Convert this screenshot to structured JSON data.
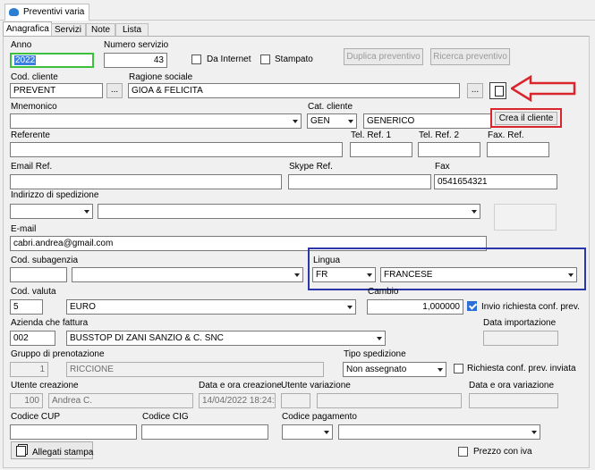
{
  "window": {
    "tab_title": "Preventivi varia"
  },
  "tabs": [
    "Anagrafica",
    "Servizi",
    "Note",
    "Lista"
  ],
  "form": {
    "anno": {
      "label": "Anno",
      "value": "2022"
    },
    "numero_servizio": {
      "label": "Numero servizio",
      "value": "43"
    },
    "da_internet": {
      "label": "Da Internet"
    },
    "stampato": {
      "label": "Stampato"
    },
    "duplica_preventivo": "Duplica preventivo",
    "ricerca_preventivo": "Ricerca preventivo",
    "cod_cliente": {
      "label": "Cod. cliente",
      "value": "PREVENT"
    },
    "ragione_sociale": {
      "label": "Ragione sociale",
      "value": "GIOA & FELICITA"
    },
    "ellipsis": "...",
    "mnemonico": {
      "label": "Mnemonico",
      "value": ""
    },
    "cat_cliente": {
      "label": "Cat. cliente",
      "code": "GEN",
      "desc": "GENERICO"
    },
    "crea_cliente": "Crea il cliente",
    "referente": {
      "label": "Referente"
    },
    "tel_ref_1": {
      "label": "Tel. Ref. 1"
    },
    "tel_ref_2": {
      "label": "Tel. Ref. 2"
    },
    "fax_ref": {
      "label": "Fax. Ref."
    },
    "email_ref": {
      "label": "Email Ref."
    },
    "skype_ref": {
      "label": "Skype Ref."
    },
    "fax": {
      "label": "Fax",
      "value": "0541654321"
    },
    "indirizzo_spedizione": {
      "label": "Indirizzo di spedizione"
    },
    "email": {
      "label": "E-mail",
      "value": "cabri.andrea@gmail.com"
    },
    "cod_subagenzia": {
      "label": "Cod. subagenzia"
    },
    "lingua": {
      "label": "Lingua",
      "code": "FR",
      "desc": "FRANCESE"
    },
    "cod_valuta": {
      "label": "Cod. valuta",
      "code": "5",
      "desc": "EURO"
    },
    "cambio": {
      "label": "Cambio",
      "value": "1,000000"
    },
    "invio_richiesta": {
      "label": "Invio richiesta conf. prev."
    },
    "azienda_fattura": {
      "label": "Azienda che fattura",
      "code": "002",
      "desc": "BUSSTOP DI ZANI SANZIO & C. SNC"
    },
    "data_importazione": {
      "label": "Data importazione"
    },
    "gruppo_prenotazione": {
      "label": "Gruppo di prenotazione",
      "code": "1",
      "desc": "RICCIONE"
    },
    "tipo_spedizione": {
      "label": "Tipo spedizione",
      "value": "Non assegnato"
    },
    "richiesta_inviata": {
      "label": "Richiesta conf. prev. inviata"
    },
    "utente_creazione": {
      "label": "Utente creazione",
      "code": "100",
      "name": "Andrea C."
    },
    "data_creazione": {
      "label": "Data e ora creazione",
      "value": "14/04/2022 18:24:"
    },
    "utente_variazione": {
      "label": "Utente variazione"
    },
    "data_variazione": {
      "label": "Data e ora variazione"
    },
    "codice_cup": {
      "label": "Codice CUP"
    },
    "codice_cig": {
      "label": "Codice CIG"
    },
    "codice_pagamento": {
      "label": "Codice pagamento"
    },
    "allegati_stampa": "Allegati stampa",
    "prezzo_con_iva": {
      "label": "Prezzo con iva"
    }
  },
  "colors": {
    "annotation_red": "#d9252b",
    "annotation_blue": "#2b36a8",
    "focus_green": "#3dc03d",
    "selected_blue": "#3b7fe0"
  }
}
